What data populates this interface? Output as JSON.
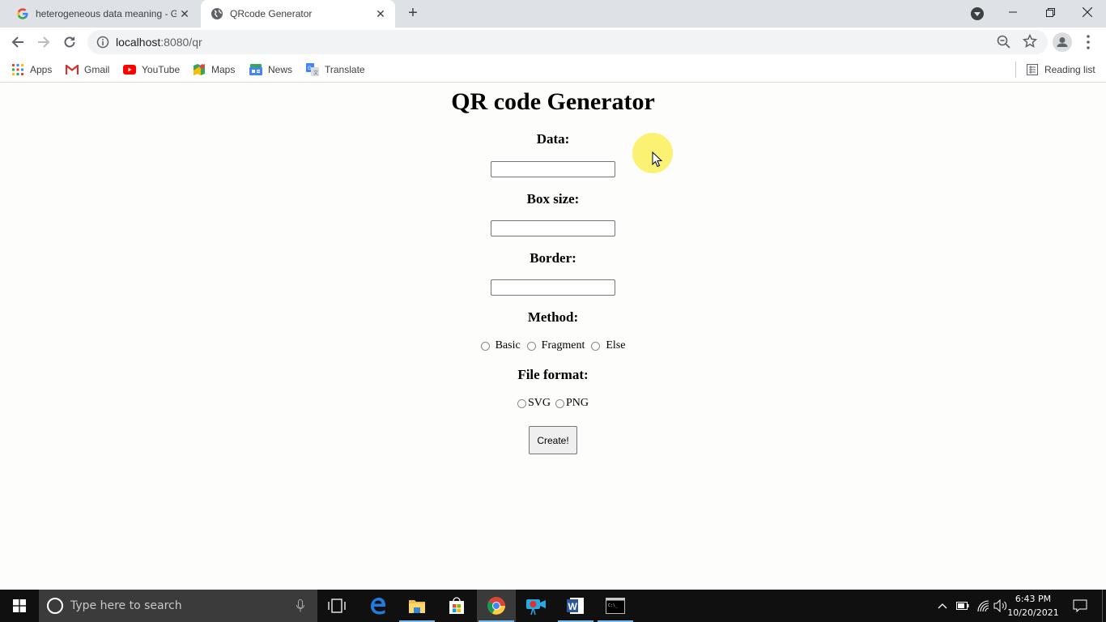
{
  "browser": {
    "tabs": [
      {
        "title": "heterogeneous data meaning - Google Search",
        "favicon": "google-g-icon",
        "active": false
      },
      {
        "title": "QRcode Generator",
        "favicon": "globe-icon",
        "active": true
      }
    ],
    "new_tab_label": "+",
    "url_host": "localhost",
    "url_rest": ":8080/qr",
    "bookmarks": [
      {
        "label": "Apps",
        "icon": "apps-grid-icon"
      },
      {
        "label": "Gmail",
        "icon": "gmail-icon"
      },
      {
        "label": "YouTube",
        "icon": "youtube-icon"
      },
      {
        "label": "Maps",
        "icon": "maps-icon"
      },
      {
        "label": "News",
        "icon": "news-icon"
      },
      {
        "label": "Translate",
        "icon": "translate-icon"
      }
    ],
    "reading_list_label": "Reading list"
  },
  "page": {
    "title": "QR code Generator",
    "fields": {
      "data_label": "Data:",
      "data_value": "",
      "box_size_label": "Box size:",
      "box_size_value": "",
      "border_label": "Border:",
      "border_value": ""
    },
    "method": {
      "label": "Method:",
      "options": [
        "Basic",
        "Fragment",
        "Else"
      ],
      "selected": null
    },
    "file_format": {
      "label": "File format:",
      "options": [
        "SVG",
        "PNG"
      ],
      "selected": null
    },
    "create_button": "Create!"
  },
  "taskbar": {
    "search_placeholder": "Type here to search",
    "apps": [
      "task-view",
      "edge",
      "file-explorer",
      "store",
      "chrome",
      "camera",
      "word",
      "terminal"
    ],
    "active_app": "chrome",
    "time": "6:43 PM",
    "date": "10/20/2021"
  },
  "colors": {
    "page_background": "#fdfefb",
    "tabstrip": "#dee1e6",
    "taskbar": "#101010",
    "cursor_highlight": "#faf05a"
  }
}
